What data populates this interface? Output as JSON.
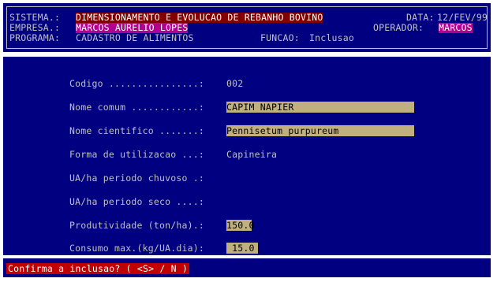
{
  "header": {
    "sistema_label": "SISTEMA.:",
    "sistema_value": "DIMENSIONAMENTO E EVOLUCAO DE REBANHO BOVINO",
    "data_label": "DATA:",
    "data_value": "12/FEV/99",
    "empresa_label": "EMPRESA.:",
    "empresa_value": "MARCOS AURELIO LOPES",
    "operador_label": "OPERADOR:",
    "operador_value": "MARCOS",
    "programa_label": "PROGRAMA:",
    "programa_value": "CADASTRO DE ALIMENTOS",
    "funcao_label": "FUNCAO:",
    "funcao_value": "Inclusao"
  },
  "form": {
    "codigo_label": "Codigo ................:",
    "codigo_value": "002",
    "nome_comum_label": "Nome comum ............:",
    "nome_comum_value": "CAPIM NAPIER",
    "nome_cientifico_label": "Nome cientifico .......:",
    "nome_cientifico_value": "Pennisetum purpureum",
    "forma_label": "Forma de utilizacao ...:",
    "forma_value": "Capineira",
    "ua_chuvoso_label": "UA/ha periodo chuvoso .:",
    "ua_chuvoso_value": "",
    "ua_seco_label": "UA/ha periodo seco ....:",
    "ua_seco_value": "",
    "produtividade_label": "Produtividade (ton/ha).:",
    "produtividade_value": "150.0",
    "consumo_label": "Consumo max.(kg/UA.dia):",
    "consumo_value": " 15.0"
  },
  "footer": {
    "prompt": "Confirma a inclusao? ( <S> / N )"
  },
  "colors": {
    "background": "#000080",
    "text": "#c0c0c0",
    "field": "#c0b080",
    "highlight_red": "#800000",
    "highlight_magenta": "#b00090",
    "prompt": "#c00000"
  }
}
